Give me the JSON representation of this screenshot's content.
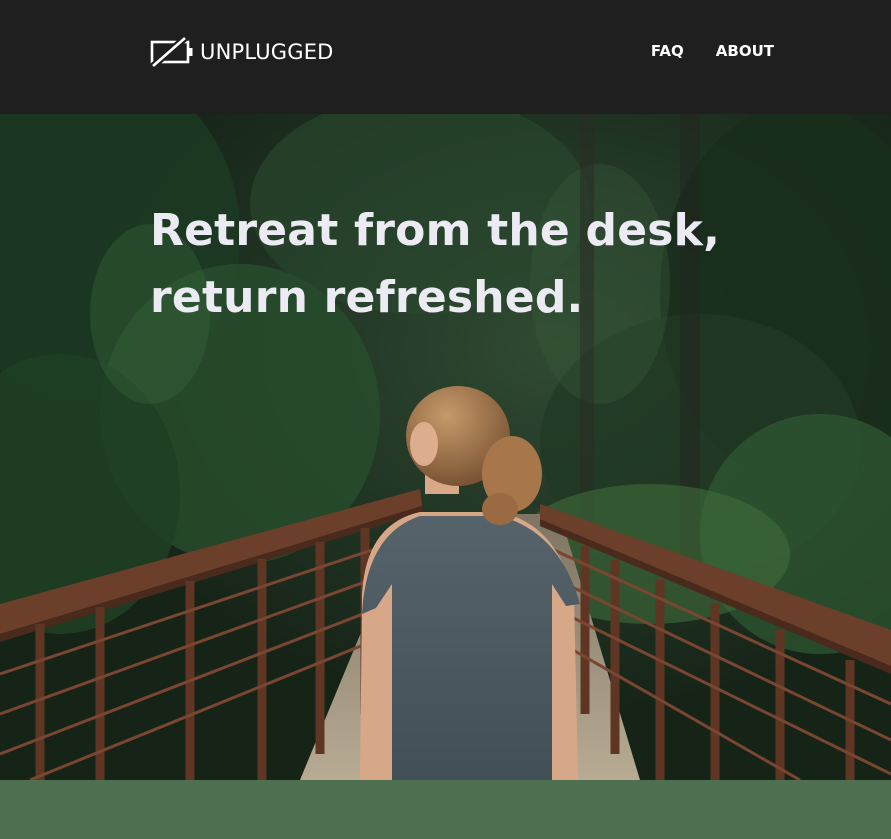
{
  "header": {
    "logo": {
      "icon": "unplugged-battery-icon",
      "text": "UNPLUGGED"
    },
    "nav": [
      {
        "label": "FAQ"
      },
      {
        "label": "ABOUT"
      }
    ]
  },
  "hero": {
    "headline_line1": "Retreat from the desk,",
    "headline_line2": "return refreshed.",
    "image": "woman-on-forest-bridge-photo"
  },
  "colors": {
    "header_bg": "#1f1f1f",
    "band_green": "#4e7050",
    "headline_text": "#ecebf3"
  }
}
